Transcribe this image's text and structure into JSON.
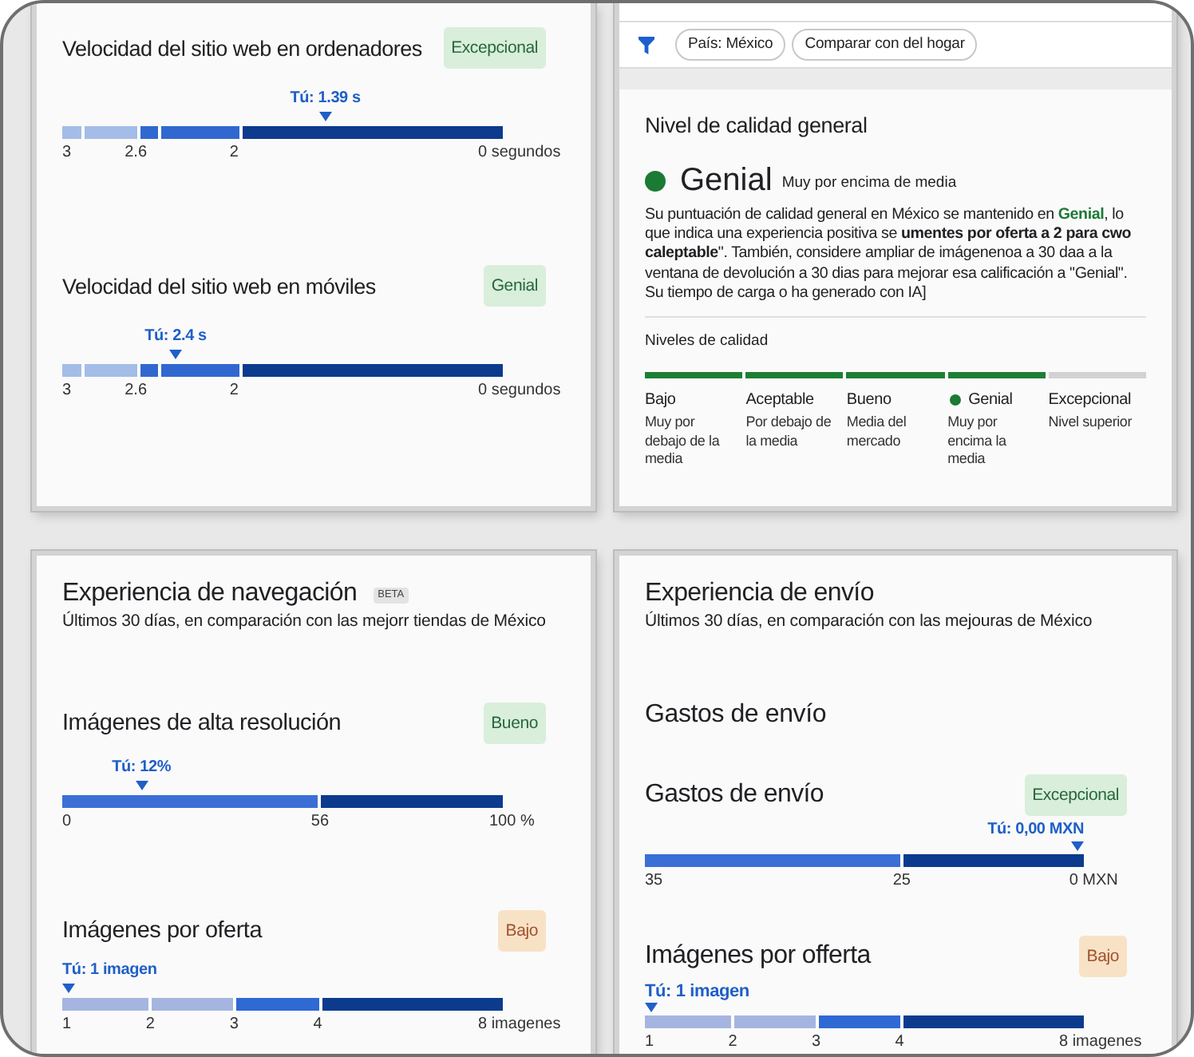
{
  "cards": [
    {
      "kind": "metrics",
      "metrics": [
        {
          "title": "Velocidad del sitio web en ordenadores",
          "rating": {
            "label": "Excepcional",
            "kind": "good"
          },
          "marker": {
            "label": "Tú: 1.39 s",
            "level": 0.6
          },
          "scale": {
            "kind": "five_band",
            "segments": [
              {
                "color": "#a4bce8",
                "label": "3"
              },
              {
                "color": "#a4bce8"
              },
              {
                "color": "#3068d0",
                "label": "2.6"
              },
              {
                "color": "#3068d0"
              },
              {
                "color": "#0c3b8e",
                "label": "2"
              }
            ],
            "end_label": "0 segundos"
          }
        },
        {
          "title": "Velocidad del sitio web en móviles",
          "rating": {
            "label": "Genial",
            "kind": "good"
          },
          "marker": {
            "label": "Tú: 2.4 s",
            "level": 0.25
          },
          "scale": {
            "kind": "five_band",
            "segments": [
              {
                "color": "#a4bce8",
                "label": "3"
              },
              {
                "color": "#a4bce8"
              },
              {
                "color": "#3068d0",
                "label": "2.6"
              },
              {
                "color": "#3068d0"
              },
              {
                "color": "#0c3b8e",
                "label": "2"
              }
            ],
            "end_label": "0 segundos"
          }
        }
      ]
    },
    {
      "kind": "quality",
      "filters": [
        "País: México",
        "Comparar con del hogar"
      ],
      "title": "Nivel de calidad general",
      "status": {
        "label": "Genial",
        "caption": "Muy por encima de media",
        "color": "#1b7a34"
      },
      "description": [
        {
          "kind": "plain",
          "text": "Su puntuación de calidad general en México se mantenido en "
        },
        {
          "kind": "highlight",
          "text": "Genial"
        },
        {
          "kind": "plain",
          "text": ", lo que indica una experiencia positiva se "
        },
        {
          "kind": "bold",
          "text": "umentes por oferta  a 2 para cwo caleptable"
        },
        {
          "kind": "plain",
          "text": "\". También, considere ampliar de imágenenoa a 30 daa a la ventana de devolución a 30 dias para mejorar esa calificación a \"Genial\". Su tiempo de carga o ha generado con IA]"
        }
      ],
      "levels_title": "Niveles de calidad",
      "levels": [
        {
          "label": "Bajo",
          "caption": "Muy por debajo de la media",
          "reached": true,
          "selected": false
        },
        {
          "label": "Aceptable",
          "caption": "Por debajo de la media",
          "reached": true,
          "selected": false
        },
        {
          "label": "Bueno",
          "caption": "Media del mercado",
          "reached": true,
          "selected": false
        },
        {
          "label": "Genial",
          "caption": "Muy por encima la media",
          "reached": true,
          "selected": true
        },
        {
          "label": "Excepcional",
          "caption": "Nivel superior",
          "reached": false,
          "selected": false
        }
      ]
    },
    {
      "kind": "metrics",
      "title": "Experiencia de navegación",
      "badge": "BETA",
      "subtitle": "Últimos 30 días, en comparación con las mejorr tiendas de México",
      "metrics": [
        {
          "title": "Imágenes de alta resolución",
          "rating": {
            "label": "Bueno",
            "kind": "good"
          },
          "marker": {
            "label": "Tú: 12%",
            "level": 0.17
          },
          "scale": {
            "kind": "two_band",
            "segments": [
              {
                "color": "#3b6fd6",
                "label": "0"
              },
              {
                "color": "#0c3b8e",
                "label": "56"
              }
            ],
            "end_label": "100 %"
          }
        },
        {
          "title": "Imágenes por oferta",
          "rating": {
            "label": "Bajo",
            "kind": "poor"
          },
          "marker": {
            "label": "Tú: 1 imagen",
            "level": 0
          },
          "scale": {
            "kind": "four_band",
            "segments": [
              {
                "color": "#a5b5e0",
                "label": "1"
              },
              {
                "color": "#a5b5e0",
                "label": "2"
              },
              {
                "color": "#2f69d4",
                "label": "3"
              },
              {
                "color": "#0c3b8e",
                "label": "4"
              }
            ],
            "end_label": "8 imagenes"
          }
        }
      ]
    },
    {
      "kind": "metrics",
      "title": "Experiencia de envío",
      "subtitle": "Últimos 30 días, en comparación con las mejouras de México",
      "section_title": "Gastos de envío",
      "metrics": [
        {
          "title": "Gastos de envío",
          "rating": {
            "label": "Excepcional",
            "kind": "good"
          },
          "marker": {
            "label": "Tú: 0,00 MXN",
            "level": 1
          },
          "scale": {
            "kind": "two_band",
            "segments": [
              {
                "color": "#3b6fd6",
                "label": "35"
              },
              {
                "color": "#0c3b8e",
                "label": "25"
              }
            ],
            "end_label": "0 MXN"
          }
        },
        {
          "title": "Imágenes por offerta",
          "rating": {
            "label": "Bajo",
            "kind": "poor"
          },
          "marker": {
            "label": "Tú: 1 imagen",
            "level": 0
          },
          "scale": {
            "kind": "four_band",
            "segments": [
              {
                "color": "#a5b5e0",
                "label": "1"
              },
              {
                "color": "#a5b5e0",
                "label": "2"
              },
              {
                "color": "#2f69d4",
                "label": "3"
              },
              {
                "color": "#0c3b8e",
                "label": "4"
              }
            ],
            "end_label": "8 imagenes"
          }
        }
      ]
    }
  ]
}
